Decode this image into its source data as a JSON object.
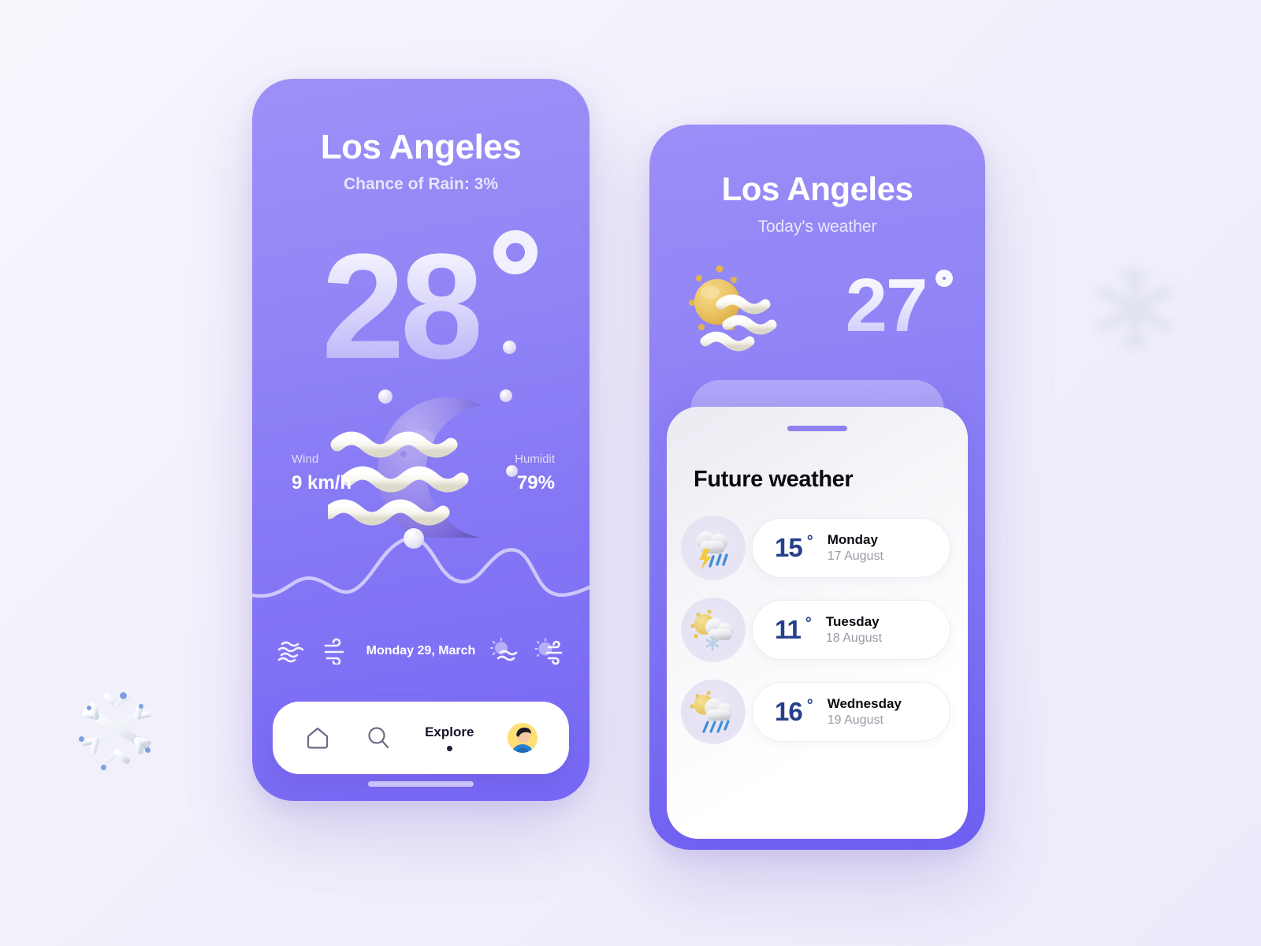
{
  "background": {
    "snowflake_left": "snowflake-icon",
    "snowflake_right": "snowflake-icon"
  },
  "phone_one": {
    "city": "Los Angeles",
    "subtitle": "Chance of Rain: 3%",
    "temperature": "28",
    "degree_symbol": "°",
    "weather_icon": "crescent-moon-fog-icon",
    "stats": {
      "wind_label": "Wind",
      "wind_value": "9 km/h",
      "humidity_label": "Humidit",
      "humidity_value": "79%"
    },
    "chart": {
      "marker_icon": "sphere-marker-icon"
    },
    "day_strip": {
      "date": "Monday 29, March",
      "icons": [
        "fog-icon",
        "wind-icon",
        "sun-fog-icon",
        "sun-wind-icon"
      ]
    },
    "navbar": {
      "home_icon": "home-icon",
      "search_icon": "search-icon",
      "explore_label": "Explore",
      "active_dot": "active-indicator-dot",
      "avatar": "avatar-icon"
    },
    "home_indicator": "home-indicator"
  },
  "phone_two": {
    "city": "Los Angeles",
    "subtitle": "Today's weather",
    "weather_icon": "sun-fog-icon",
    "temperature": "27",
    "degree_symbol": "°",
    "sheet": {
      "grabber": "drag-handle",
      "title": "Future weather",
      "forecast": [
        {
          "icon": "thunderstorm-rain-icon",
          "temp": "15",
          "degree": "°",
          "day": "Monday",
          "date": "17 August"
        },
        {
          "icon": "sun-cloud-snow-icon",
          "temp": "11",
          "degree": "°",
          "day": "Tuesday",
          "date": "18 August"
        },
        {
          "icon": "sun-cloud-rain-icon",
          "temp": "16",
          "degree": "°",
          "day": "Wednesday",
          "date": "19 August"
        }
      ]
    }
  },
  "colors": {
    "purple_light": "#9d90f7",
    "purple_deep": "#7263f3",
    "accent_navy": "#26408b",
    "sheet_white": "#ffffff",
    "grabber_purple": "#8f82f0",
    "sun_gold": "#e9bd55",
    "rain_blue": "#3f8fd6"
  }
}
